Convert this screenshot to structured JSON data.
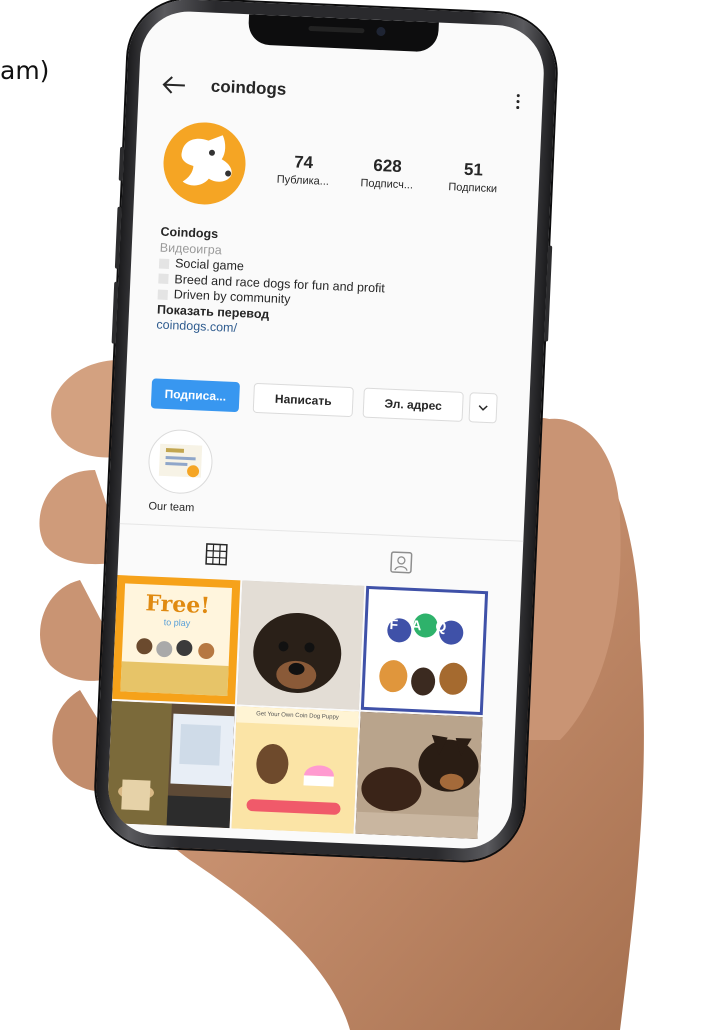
{
  "caption_text": "am)",
  "profile": {
    "username": "coindogs",
    "display_name": "Coindogs",
    "category": "Видеоигра",
    "bio_lines": [
      "Social game",
      "Breed and race dogs for fun and profit",
      "Driven by community"
    ],
    "translate_label": "Показать перевод",
    "website": "coindogs.com/",
    "avatar_color": "#f5a524"
  },
  "stats": [
    {
      "value": "74",
      "label": "Публика..."
    },
    {
      "value": "628",
      "label": "Подписч..."
    },
    {
      "value": "51",
      "label": "Подписки"
    }
  ],
  "actions": {
    "follow": "Подписа...",
    "message": "Написать",
    "email": "Эл. адрес"
  },
  "highlights": [
    {
      "label": "Our team"
    }
  ],
  "grid_posts": [
    {
      "text": "Free!",
      "subtext": "to play"
    },
    {
      "text": ""
    },
    {
      "text": "FAQ"
    },
    {
      "text": ""
    },
    {
      "text": "Get Your Own Coin Dog Puppy"
    },
    {
      "text": ""
    }
  ],
  "colors": {
    "accent_blue": "#3897f0",
    "link_blue": "#2f5c8f",
    "brand_orange": "#f5a524"
  },
  "icons": {
    "back": "arrow-left-icon",
    "menu": "more-vertical-icon",
    "grid_tab": "grid-icon",
    "tagged_tab": "tagged-person-icon",
    "dropdown": "chevron-down-icon"
  }
}
